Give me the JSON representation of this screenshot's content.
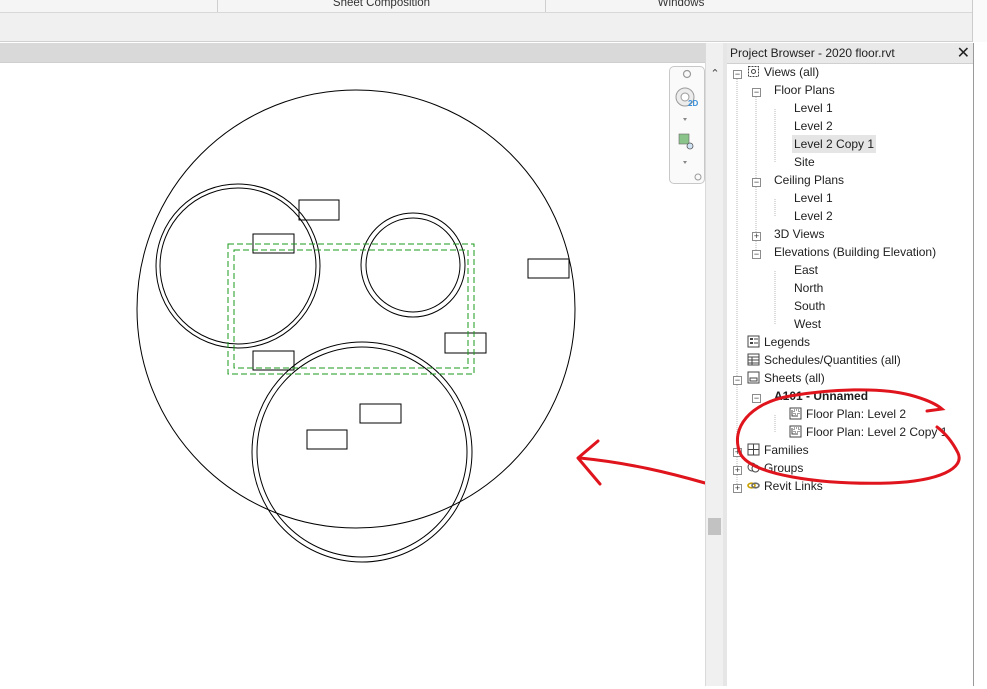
{
  "ribbon": {
    "tabs": [
      "Sheet Composition",
      "Windows"
    ]
  },
  "navigation_bar": {
    "badge_2d": "2D"
  },
  "project_browser": {
    "title": "Project Browser - 2020 floor.rvt",
    "close": "✕",
    "tree": {
      "views": "Views (all)",
      "floor_plans": "Floor Plans",
      "fp_items": [
        "Level 1",
        "Level 2",
        "Level 2 Copy 1",
        "Site"
      ],
      "ceiling_plans": "Ceiling Plans",
      "cp_items": [
        "Level 1",
        "Level 2"
      ],
      "views_3d": "3D Views",
      "elevations": "Elevations (Building Elevation)",
      "el_items": [
        "East",
        "North",
        "South",
        "West"
      ],
      "legends": "Legends",
      "schedules": "Schedules/Quantities (all)",
      "sheets": "Sheets (all)",
      "sheet": "A101 - Unnamed",
      "sheet_views": [
        "Floor Plan: Level 2",
        "Floor Plan: Level 2 Copy 1"
      ],
      "families": "Families",
      "groups": "Groups",
      "revit_links": "Revit Links"
    }
  },
  "colors": {
    "annotation": "#e0141c",
    "crop_region": "#1a9a1a",
    "selection": "#e5e5e5"
  }
}
